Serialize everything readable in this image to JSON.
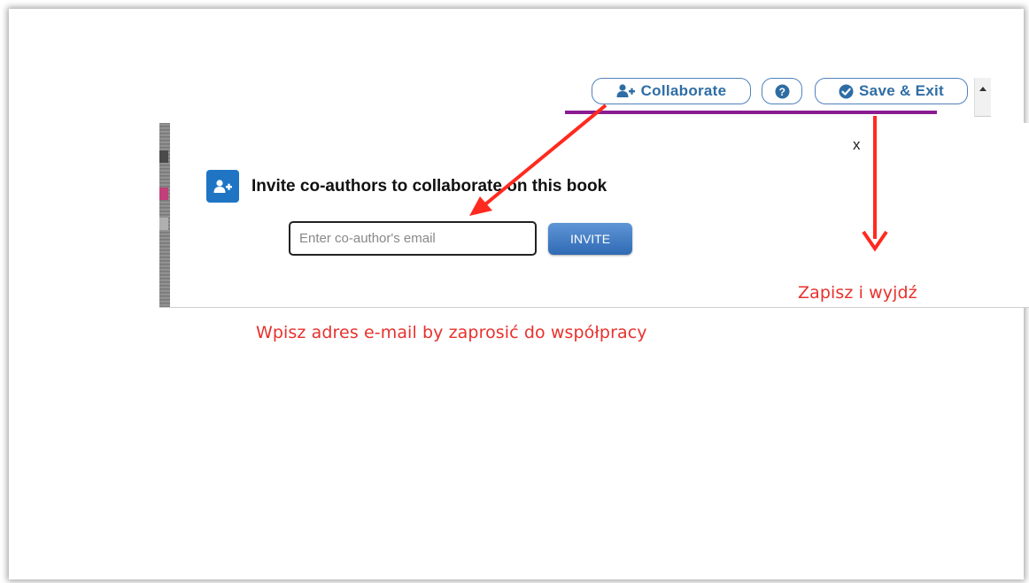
{
  "toolbar": {
    "collaborate_label": "Collaborate",
    "help_icon": "question-circle-icon",
    "save_exit_label": "Save & Exit"
  },
  "modal": {
    "close_label": "x",
    "title": "Invite co-authors to collaborate on this book",
    "email_placeholder": "Enter co-author's email",
    "invite_label": "INVITE"
  },
  "annotations": {
    "save_and_exit_note": "Zapisz i wyjdź",
    "invite_note": "Wpisz adres e-mail by zaprosić do współpracy"
  },
  "colors": {
    "accent_blue": "#2e6da4",
    "purple_bar": "#8a1c92",
    "annotation_red": "#e8312c"
  }
}
